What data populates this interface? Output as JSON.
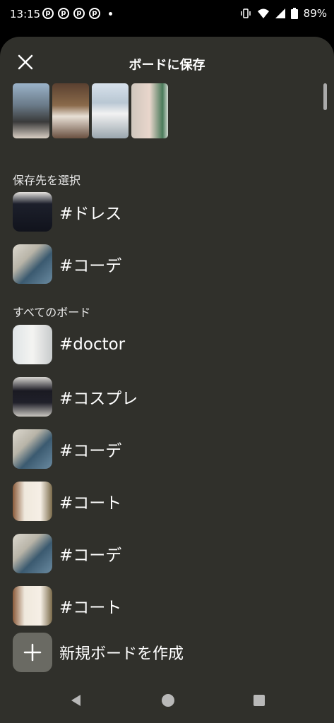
{
  "status": {
    "time": "13:15",
    "battery": "89%",
    "icons": [
      "pinterest-icon",
      "pinterest-icon",
      "pinterest-icon",
      "pinterest-icon",
      "dot-icon",
      "vibrate-icon",
      "wifi-icon",
      "signal-icon",
      "battery-icon"
    ]
  },
  "header": {
    "title": "ボードに保存"
  },
  "sections": {
    "suggested_label": "保存先を選択",
    "all_label": "すべてのボード"
  },
  "suggested_boards": [
    {
      "name": "#ドレス"
    },
    {
      "name": "#コーデ"
    }
  ],
  "all_boards": [
    {
      "name": "#doctor"
    },
    {
      "name": "#コスプレ"
    },
    {
      "name": "#コーデ"
    },
    {
      "name": "#コート"
    },
    {
      "name": "#コーデ"
    },
    {
      "name": "#コート"
    }
  ],
  "create": {
    "label": "新規ボードを作成"
  },
  "colors": {
    "sheet": "#30302b",
    "create_button": "#6a6a63"
  }
}
